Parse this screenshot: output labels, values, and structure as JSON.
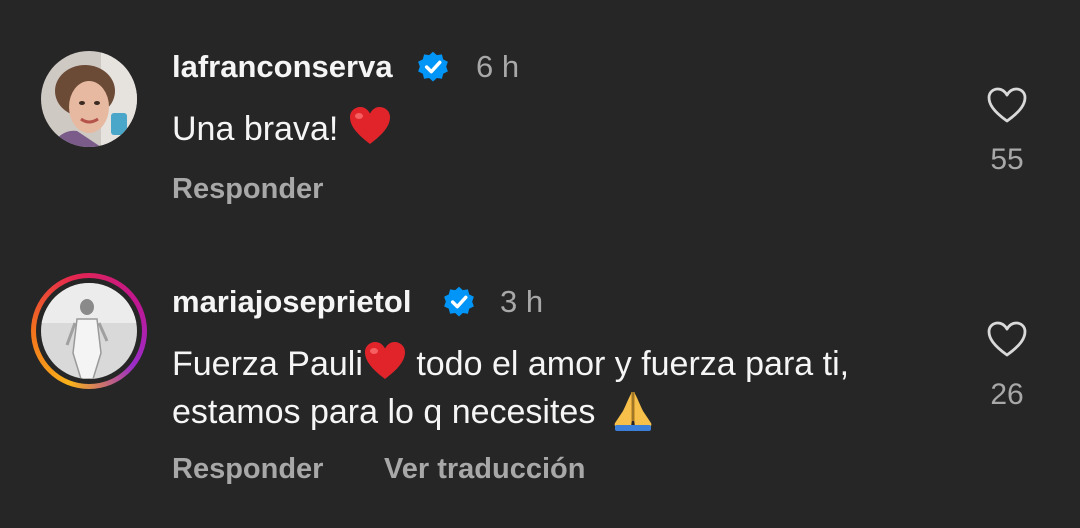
{
  "comments": [
    {
      "username": "lafranconserva",
      "time": "6 h",
      "text": "Una brava!",
      "reply_label": "Responder",
      "likes": "55",
      "verified": true,
      "has_story_ring": false
    },
    {
      "username": "mariajoseprietol",
      "time": "3 h",
      "text_part1": "Fuerza Pauli",
      "text_part2": " todo el amor y fuerza para ti, estamos para lo q necesites",
      "reply_label": "Responder",
      "translate_label": "Ver traducción",
      "likes": "26",
      "verified": true,
      "has_story_ring": true
    }
  ],
  "colors": {
    "background": "#262627",
    "verified_blue": "#0095f6",
    "secondary_text": "#a8a8a8",
    "heart_red": "#e0242a"
  },
  "icons": {
    "verified": "verified-badge-icon",
    "like": "heart-outline-icon",
    "emoji_heart": "red-heart-emoji",
    "emoji_pray": "folded-hands-emoji"
  }
}
